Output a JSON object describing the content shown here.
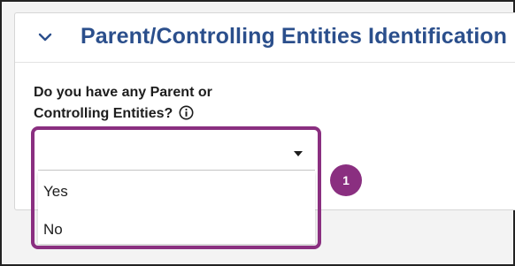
{
  "section": {
    "title": "Parent/Controlling Entities Identification",
    "icon": "chevron-down-icon",
    "accent_color": "#2b4f8c"
  },
  "question": {
    "line1": "Do you have any Parent or",
    "line2": "Controlling Entities?",
    "info_icon": "info-circle-icon"
  },
  "dropdown": {
    "selected_value": "",
    "options": [
      {
        "label": "Yes"
      },
      {
        "label": "No"
      }
    ],
    "caret_icon": "caret-down-icon"
  },
  "annotation": {
    "step_number": "1",
    "highlight_color": "#8a2f80"
  }
}
